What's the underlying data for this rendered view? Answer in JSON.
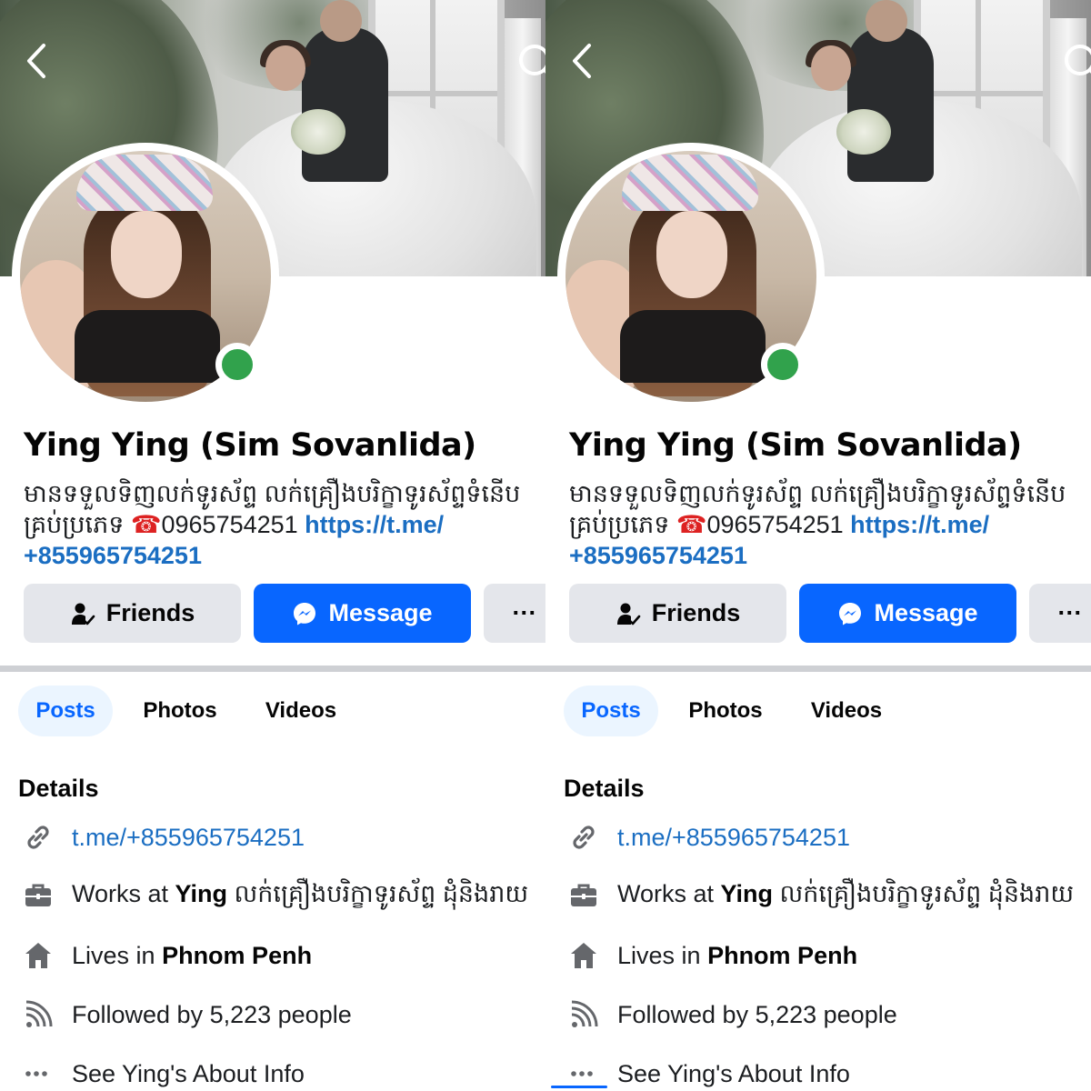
{
  "profile": {
    "name": "Ying Ying (Sim Sovanlida)",
    "bio_line1": "មានទទួលទិញលក់ទូរស័ព្ទ លក់គ្រឿងបរិក្ខាទូរស័ព្ទទំនើប",
    "bio_line2_text": "គ្រប់ប្រភេទ ",
    "bio_phone_icon": "☎",
    "bio_phone": "0965754251 ",
    "bio_link_part1": "https://t.me/",
    "bio_link_part2": "+855965754251"
  },
  "actions": {
    "friends_label": "Friends",
    "message_label": "Message",
    "more_label": "···"
  },
  "tabs": [
    {
      "label": "Posts",
      "active": true
    },
    {
      "label": "Photos",
      "active": false
    },
    {
      "label": "Videos",
      "active": false
    }
  ],
  "details": {
    "title": "Details",
    "link": "t.me/+855965754251",
    "work_prefix": "Works at ",
    "work_name": "Ying",
    "work_suffix": " លក់គ្រឿងបរិក្ខាទូរស័ព្ទ ដុំនិងរាយ",
    "lives_prefix": "Lives in ",
    "lives_place": "Phnom Penh",
    "followed_by": "Followed by 5,223 people",
    "about_label": "See Ying's About Info"
  },
  "icons": {
    "back": "chevron-left-icon",
    "search": "search-icon",
    "friends": "friends-check-icon",
    "message": "messenger-icon",
    "more": "more-dots-icon",
    "link": "link-icon",
    "work": "briefcase-icon",
    "home": "home-icon",
    "followers": "rss-followers-icon",
    "about": "more-dots-icon"
  },
  "colors": {
    "accent": "#0866ff",
    "link": "#1b6ec2",
    "online": "#31a24c",
    "button_gray": "#e4e6eb",
    "tab_active_bg": "#ebf5ff"
  }
}
